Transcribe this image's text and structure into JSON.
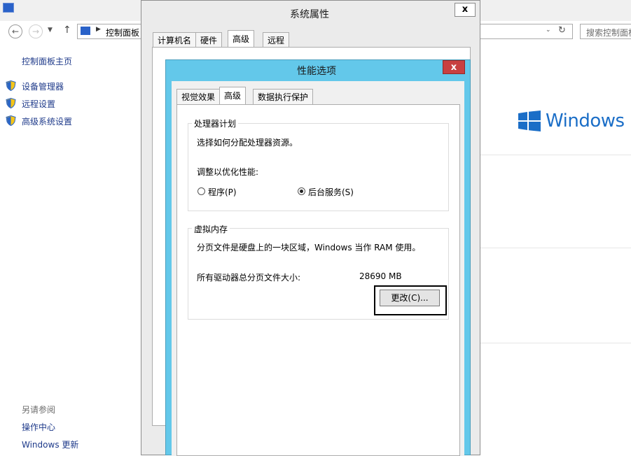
{
  "background_window": {
    "breadcrumb_root": "控制面板",
    "search_placeholder": "搜索控制面板",
    "sidebar": {
      "home": "控制面板主页",
      "items": [
        {
          "label": "设备管理器",
          "icon": "shield-icon"
        },
        {
          "label": "远程设置",
          "icon": "shield-icon"
        },
        {
          "label": "高级系统设置",
          "icon": "shield-icon"
        }
      ],
      "see_also_title": "另请参阅",
      "see_also": [
        "操作中心",
        "Windows 更新"
      ]
    },
    "brand": "Windows Se"
  },
  "system_properties": {
    "title": "系统属性",
    "close": "x",
    "tabs": [
      "计算机名",
      "硬件",
      "高级",
      "远程"
    ],
    "active_tab": "高级"
  },
  "performance_options": {
    "title": "性能选项",
    "close": "x",
    "tabs": [
      "视觉效果",
      "高级",
      "数据执行保护"
    ],
    "active_tab": "高级",
    "processor": {
      "group": "处理器计划",
      "desc": "选择如何分配处理器资源。",
      "adjust_label": "调整以优化性能:",
      "options": [
        {
          "label": "程序(P)",
          "selected": false
        },
        {
          "label": "后台服务(S)",
          "selected": true
        }
      ]
    },
    "virtual_memory": {
      "group": "虚拟内存",
      "desc": "分页文件是硬盘上的一块区域，Windows 当作 RAM 使用。",
      "size_label": "所有驱动器总分页文件大小:",
      "size_value": "28690 MB",
      "change_button": "更改(C)..."
    }
  }
}
